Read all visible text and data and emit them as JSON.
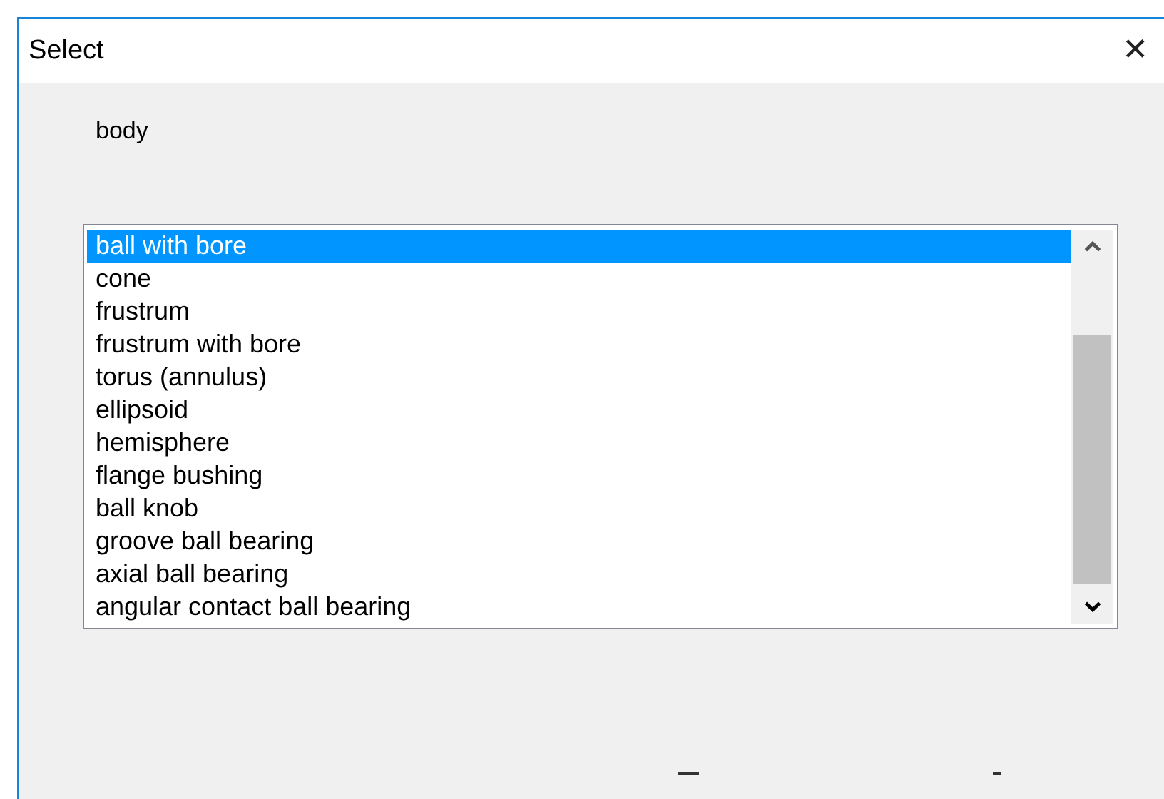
{
  "window": {
    "title": "Select",
    "close": "✕"
  },
  "label": "body",
  "list": {
    "items": [
      {
        "text": "ball with bore",
        "selected": true
      },
      {
        "text": "cone",
        "selected": false
      },
      {
        "text": "frustrum",
        "selected": false
      },
      {
        "text": "frustrum with bore",
        "selected": false
      },
      {
        "text": "torus (annulus)",
        "selected": false
      },
      {
        "text": "ellipsoid",
        "selected": false
      },
      {
        "text": "hemisphere",
        "selected": false
      },
      {
        "text": "flange bushing",
        "selected": false
      },
      {
        "text": "ball knob",
        "selected": false
      },
      {
        "text": "groove ball bearing",
        "selected": false
      },
      {
        "text": "axial ball bearing",
        "selected": false
      },
      {
        "text": "angular contact ball bearing",
        "selected": false
      }
    ]
  }
}
